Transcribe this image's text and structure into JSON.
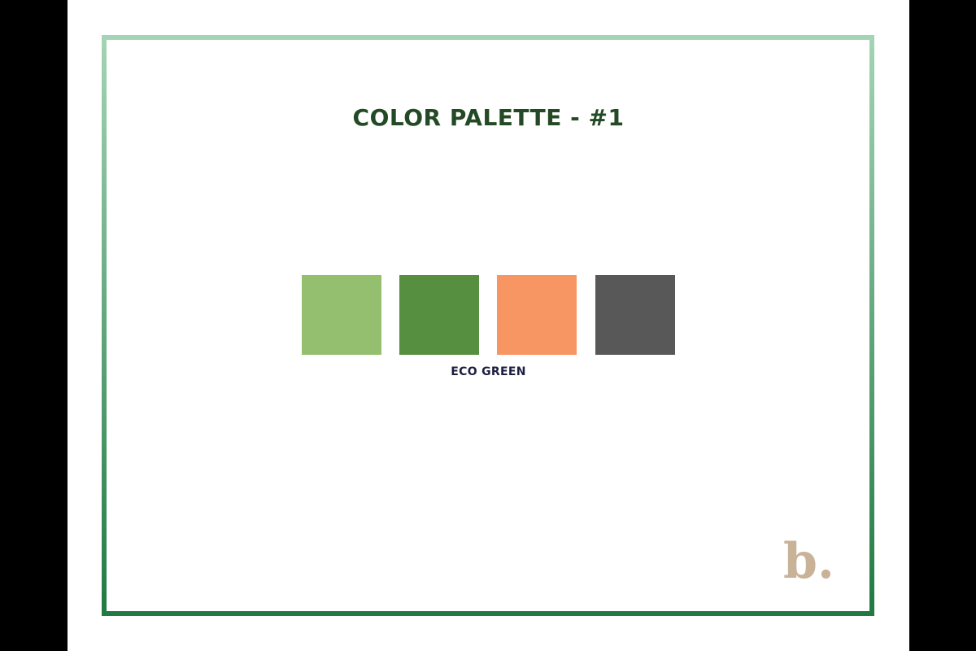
{
  "title": "COLOR PALETTE - #1",
  "palette": {
    "name": "ECO GREEN",
    "swatches": [
      {
        "color": "#93bf6e"
      },
      {
        "color": "#568f40"
      },
      {
        "color": "#f79663"
      },
      {
        "color": "#585858"
      }
    ]
  },
  "logo": {
    "text": "b."
  },
  "colors": {
    "frame_top": "#a3d4b5",
    "frame_bottom": "#217a43",
    "title": "#234a24",
    "label": "#1b1f3f",
    "logo": "#c9b398"
  }
}
